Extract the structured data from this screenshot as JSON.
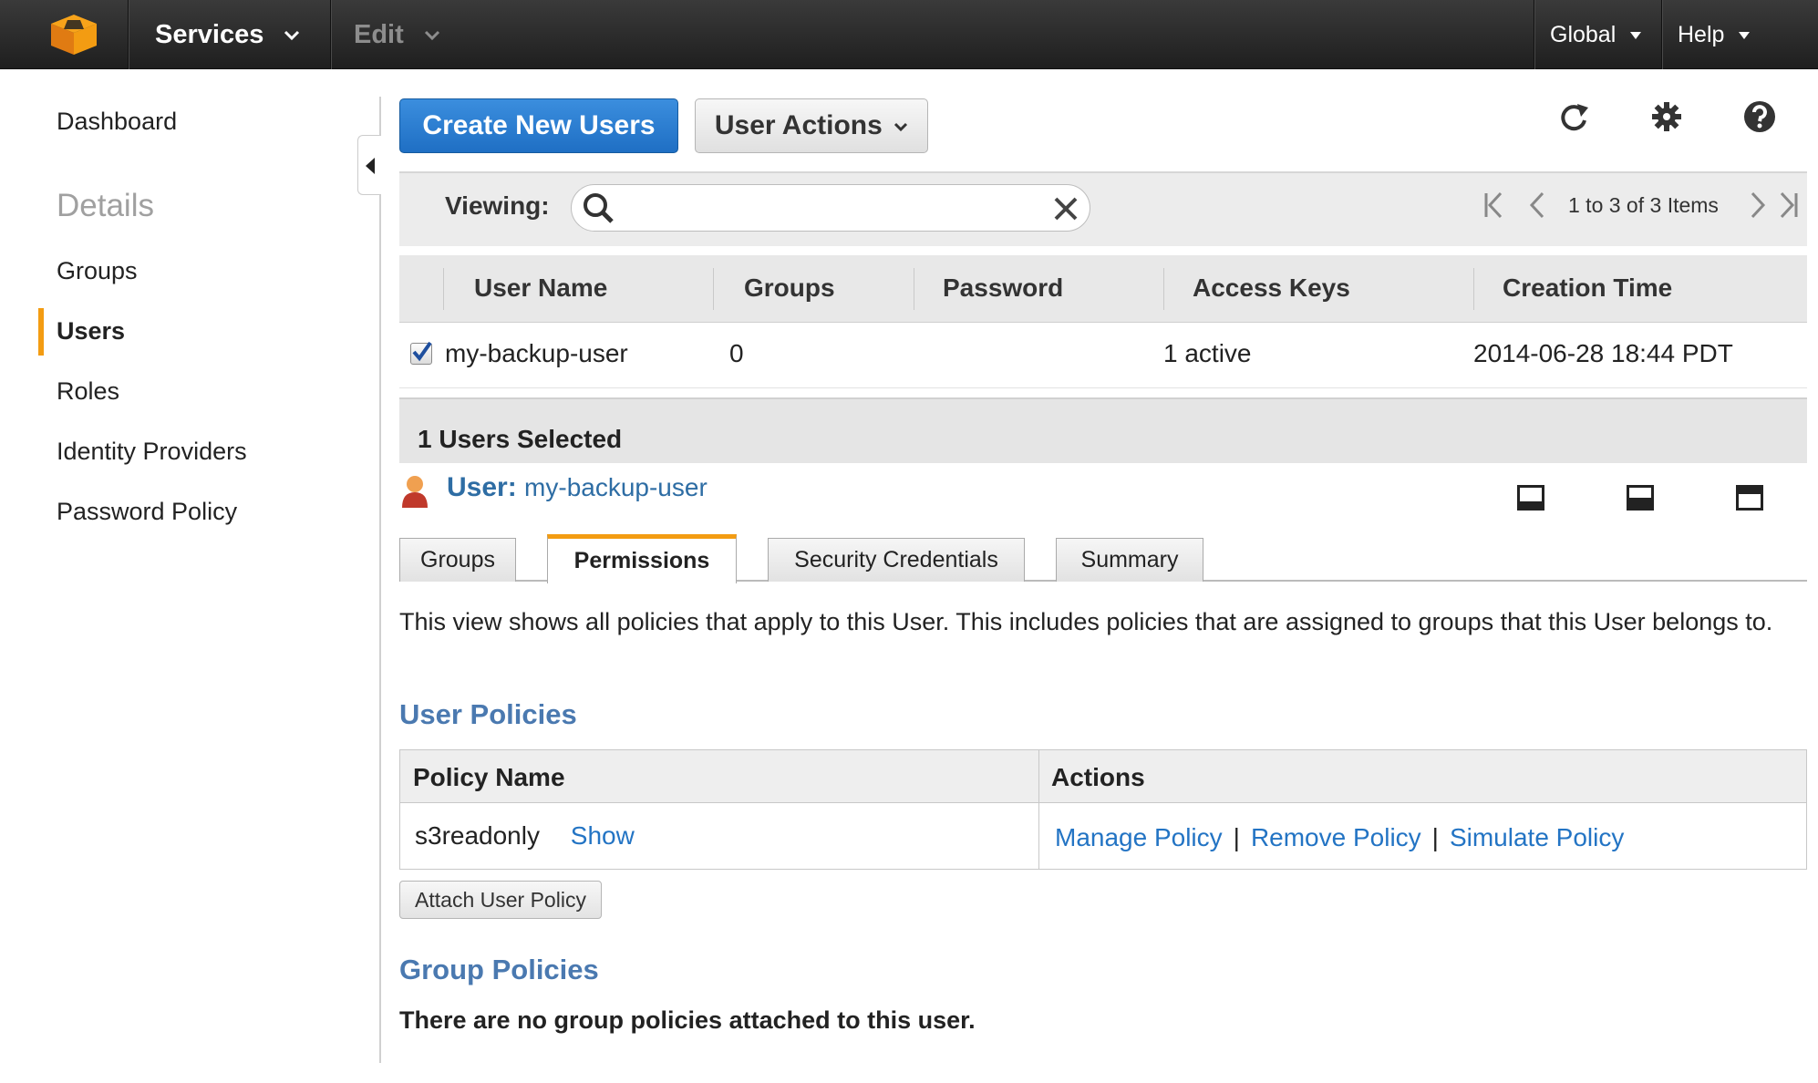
{
  "topbar": {
    "services_label": "Services",
    "edit_label": "Edit",
    "region_label": "Global",
    "help_label": "Help"
  },
  "sidebar": {
    "items": [
      {
        "label": "Dashboard"
      },
      {
        "label": "Details"
      },
      {
        "label": "Groups"
      },
      {
        "label": "Users"
      },
      {
        "label": "Roles"
      },
      {
        "label": "Identity Providers"
      },
      {
        "label": "Password Policy"
      }
    ],
    "active": "Users"
  },
  "toolbar": {
    "create_label": "Create New Users",
    "actions_label": "User Actions"
  },
  "filter": {
    "label": "Viewing:",
    "search_value": "",
    "pager_text": "1 to 3 of 3 Items"
  },
  "users_table": {
    "columns": [
      "User Name",
      "Groups",
      "Password",
      "Access Keys",
      "Creation Time"
    ],
    "rows": [
      {
        "user_name": "my-backup-user",
        "groups": "0",
        "password": "",
        "access_keys": "1 active",
        "creation_time": "2014-06-28 18:44 PDT",
        "selected": true
      }
    ]
  },
  "selection": {
    "summary": "1 Users Selected",
    "user_label": "User:",
    "user_name": "my-backup-user"
  },
  "tabs": [
    {
      "label": "Groups"
    },
    {
      "label": "Permissions"
    },
    {
      "label": "Security Credentials"
    },
    {
      "label": "Summary"
    }
  ],
  "active_tab": "Permissions",
  "permissions": {
    "description": "This view shows all policies that apply to this User. This includes policies that are assigned to groups that this User belongs to.",
    "user_policies_heading": "User Policies",
    "policy_columns": [
      "Policy Name",
      "Actions"
    ],
    "policies": [
      {
        "name": "s3readonly",
        "show_label": "Show",
        "actions": [
          "Manage Policy",
          "Remove Policy",
          "Simulate Policy"
        ]
      }
    ],
    "attach_label": "Attach User Policy",
    "group_policies_heading": "Group Policies",
    "group_policies_note": "There are no group policies attached to this user."
  },
  "colors": {
    "accent_orange": "#f39c12",
    "primary_blue": "#2374c4",
    "heading_blue": "#4a79b0",
    "topbar_bg": "#232323"
  }
}
